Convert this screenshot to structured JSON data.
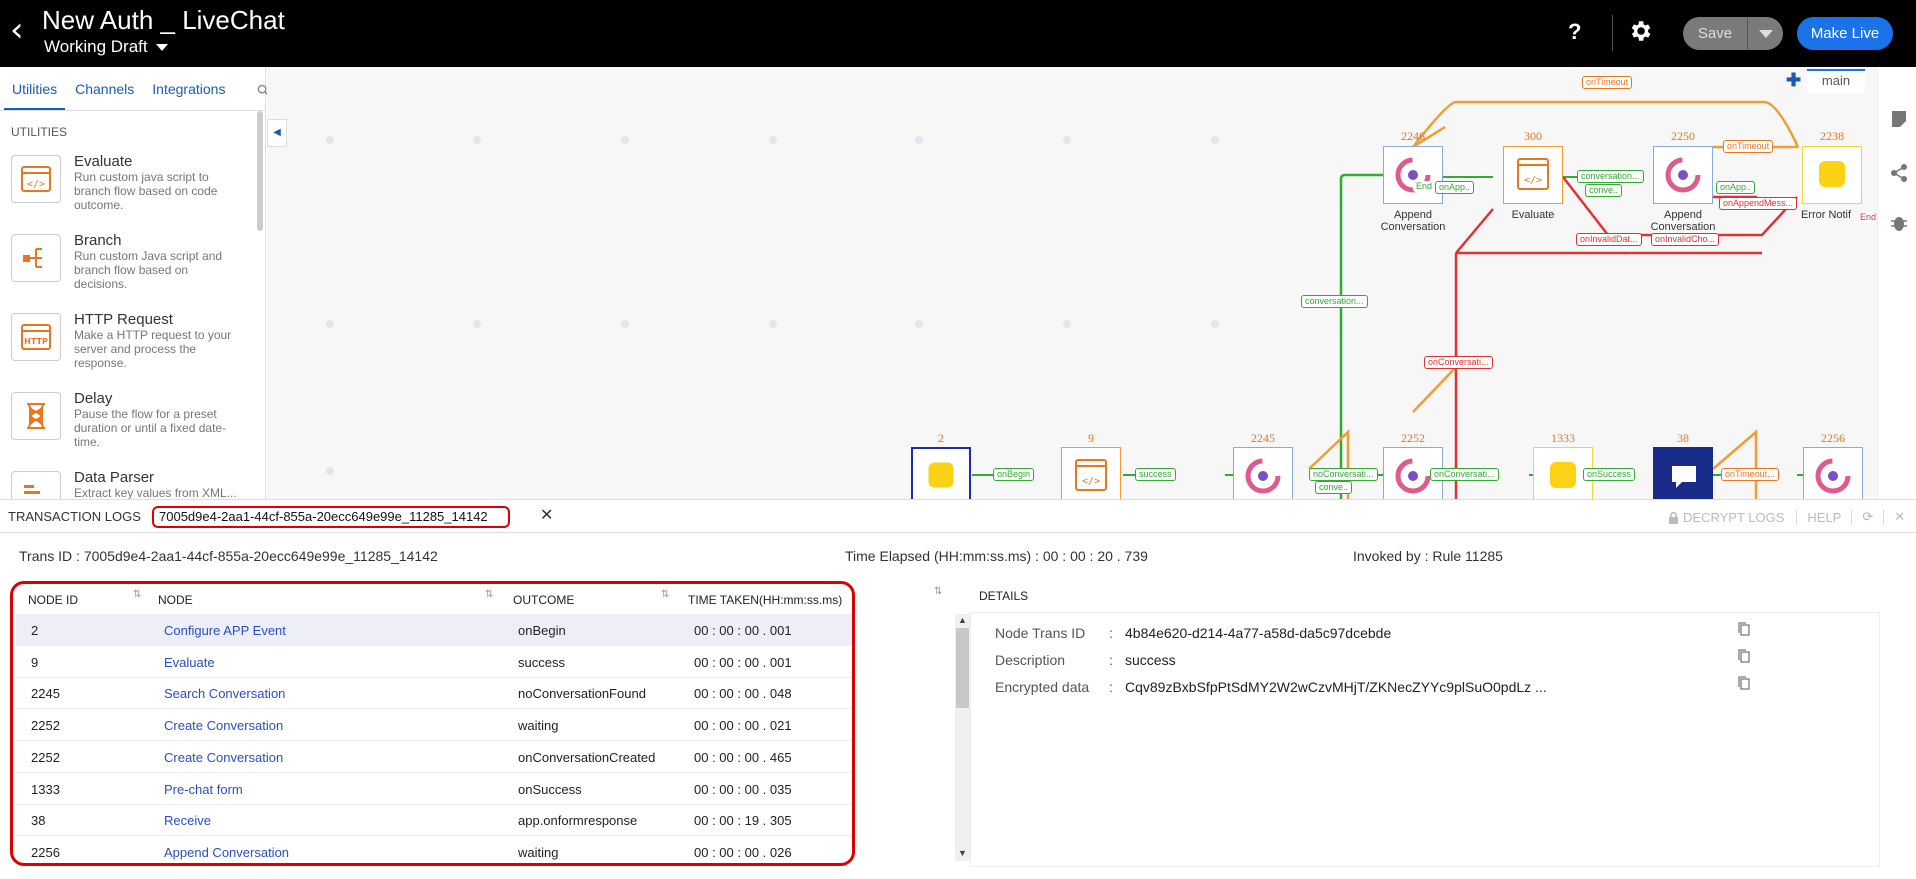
{
  "header": {
    "title": "New Auth _ LiveChat",
    "draft_label": "Working Draft",
    "help_label": "?",
    "save_label": "Save",
    "make_live_label": "Make Live"
  },
  "left_panel": {
    "tabs": [
      "Utilities",
      "Channels",
      "Integrations"
    ],
    "section_label": "UTILITIES",
    "items": [
      {
        "name": "Evaluate",
        "desc": "Run custom java script to branch flow based on code outcome."
      },
      {
        "name": "Branch",
        "desc": "Run custom Java script and branch flow based on decisions."
      },
      {
        "name": "HTTP Request",
        "desc": "Make a HTTP request to your server and process the response."
      },
      {
        "name": "Delay",
        "desc": "Pause the flow for a preset duration or until a fixed date-time."
      },
      {
        "name": "Data Parser",
        "desc": "Extract key values from XML..."
      }
    ]
  },
  "canvas": {
    "main_tab": "main",
    "nodes": [
      {
        "id": "2246",
        "label": "Append Conversation"
      },
      {
        "id": "300",
        "label": "Evaluate"
      },
      {
        "id": "2250",
        "label": "Append Conversation"
      },
      {
        "id": "2238",
        "label": "Error Notif"
      },
      {
        "id": "2",
        "label": ""
      },
      {
        "id": "9",
        "label": ""
      },
      {
        "id": "2245",
        "label": ""
      },
      {
        "id": "2252",
        "label": ""
      },
      {
        "id": "1333",
        "label": ""
      },
      {
        "id": "38",
        "label": ""
      },
      {
        "id": "2256",
        "label": ""
      }
    ],
    "edge_labels": {
      "on_timeout": "onTimeout",
      "on_timeout_2": "onTimeout",
      "conversation_1": "conversation...",
      "conversation_2": "conversation...",
      "end_onapp_1": "onApp..",
      "end_onapp_2": "onApp..",
      "end_conv": "conve..",
      "end_conv_2": "conve..",
      "on_append_mess": "onAppendMess...",
      "on_invalid_1": "onInvalidDat...",
      "on_invalid_2": "onInvalidCho...",
      "on_conversati_red": "onConversati...",
      "on_begin": "onBegin",
      "success": "success",
      "no_conversati": "noConversati...",
      "on_conversati_green": "onConversati...",
      "on_success": "onSuccess",
      "on_timeout_3": "onTimeout...",
      "end_label": "End",
      "end_label_right": "End"
    }
  },
  "logs": {
    "title": "TRANSACTION LOGS",
    "tab_id": "7005d9e4-2aa1-44cf-855a-20ecc649e99e_11285_14142",
    "decrypt_label": "DECRYPT LOGS",
    "help_label": "HELP",
    "trans_id_text": "Trans ID : 7005d9e4-2aa1-44cf-855a-20ecc649e99e_11285_14142",
    "time_elapsed_text": "Time Elapsed (HH:mm:ss.ms) :  00 : 00 : 20 . 739",
    "invoked_by_text": "Invoked by : Rule 11285",
    "columns": [
      "NODE ID",
      "NODE",
      "OUTCOME",
      "TIME TAKEN(HH:mm:ss.ms)"
    ],
    "rows": [
      {
        "id": "2",
        "node": "Configure APP Event",
        "outcome": "onBegin",
        "time": "00 : 00 : 00 . 001"
      },
      {
        "id": "9",
        "node": "Evaluate",
        "outcome": "success",
        "time": "00 : 00 : 00 . 001"
      },
      {
        "id": "2245",
        "node": "Search Conversation",
        "outcome": "noConversationFound",
        "time": "00 : 00 : 00 . 048"
      },
      {
        "id": "2252",
        "node": "Create Conversation",
        "outcome": "waiting",
        "time": "00 : 00 : 00 . 021"
      },
      {
        "id": "2252",
        "node": "Create Conversation",
        "outcome": "onConversationCreated",
        "time": "00 : 00 : 00 . 465"
      },
      {
        "id": "1333",
        "node": "Pre-chat form",
        "outcome": "onSuccess",
        "time": "00 : 00 : 00 . 035"
      },
      {
        "id": "38",
        "node": "Receive",
        "outcome": "app.onformresponse",
        "time": "00 : 00 : 19 . 305"
      },
      {
        "id": "2256",
        "node": "Append Conversation",
        "outcome": "waiting",
        "time": "00 : 00 : 00 . 026"
      }
    ],
    "details_title": "DETAILS",
    "details": [
      {
        "key": "Node Trans ID",
        "value": "4b84e620-d214-4a77-a58d-da5c97dcebde"
      },
      {
        "key": "Description",
        "value": "success"
      },
      {
        "key": "Encrypted data",
        "value": "Cqv89zBxbSfpPtSdMY2W2wCzvMHjT/ZKNecZYYc9plSuO0pdLz ..."
      }
    ],
    "separator": ":"
  },
  "colors": {
    "accent": "#1a73e8",
    "highlight": "#dd0000",
    "node_orange": "#e87722",
    "edge_green": "#33aa33",
    "edge_red": "#dd3333"
  }
}
